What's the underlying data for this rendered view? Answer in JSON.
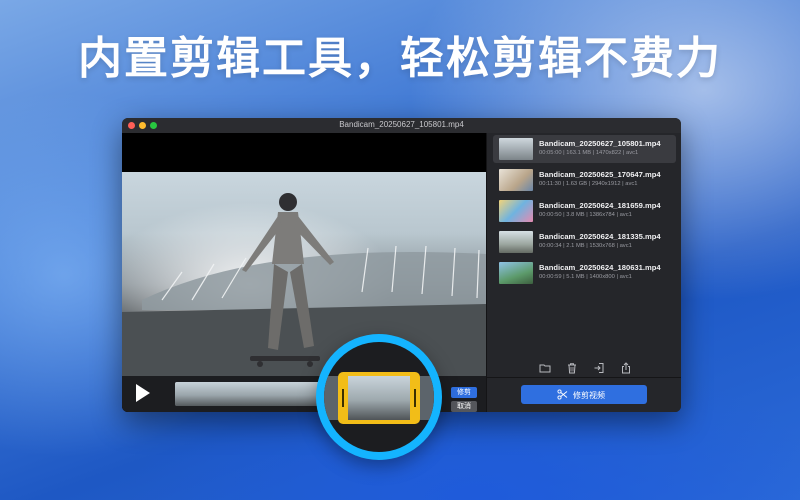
{
  "headline": "内置剪辑工具，轻松剪辑不费力",
  "window": {
    "title": "Bandicam_20250627_105801.mp4"
  },
  "player": {
    "trim_label": "修剪",
    "cancel_label": "取消"
  },
  "files": [
    {
      "name": "Bandicam_20250627_105801.mp4",
      "meta": "00:05:00 | 163.1 MB | 1470x822 | avc1",
      "selected": true
    },
    {
      "name": "Bandicam_20250625_170647.mp4",
      "meta": "00:11:30 | 1.63 GB | 2940x1912 | avc1",
      "selected": false
    },
    {
      "name": "Bandicam_20250624_181659.mp4",
      "meta": "00:00:50 | 3.8 MB | 1386x784 | avc1",
      "selected": false
    },
    {
      "name": "Bandicam_20250624_181335.mp4",
      "meta": "00:00:34 | 2.1 MB | 1530x768 | avc1",
      "selected": false
    },
    {
      "name": "Bandicam_20250624_180631.mp4",
      "meta": "00:00:59 | 5.1 MB | 1400x800 | avc1",
      "selected": false
    }
  ],
  "sidebar": {
    "tools": [
      "folder-icon",
      "trash-icon",
      "import-icon",
      "share-icon"
    ],
    "trim_video_label": "修剪视频"
  },
  "colors": {
    "accent": "#2f6fe0",
    "trim_handle": "#f2bd18",
    "magnifier_ring": "#14b4ff"
  }
}
